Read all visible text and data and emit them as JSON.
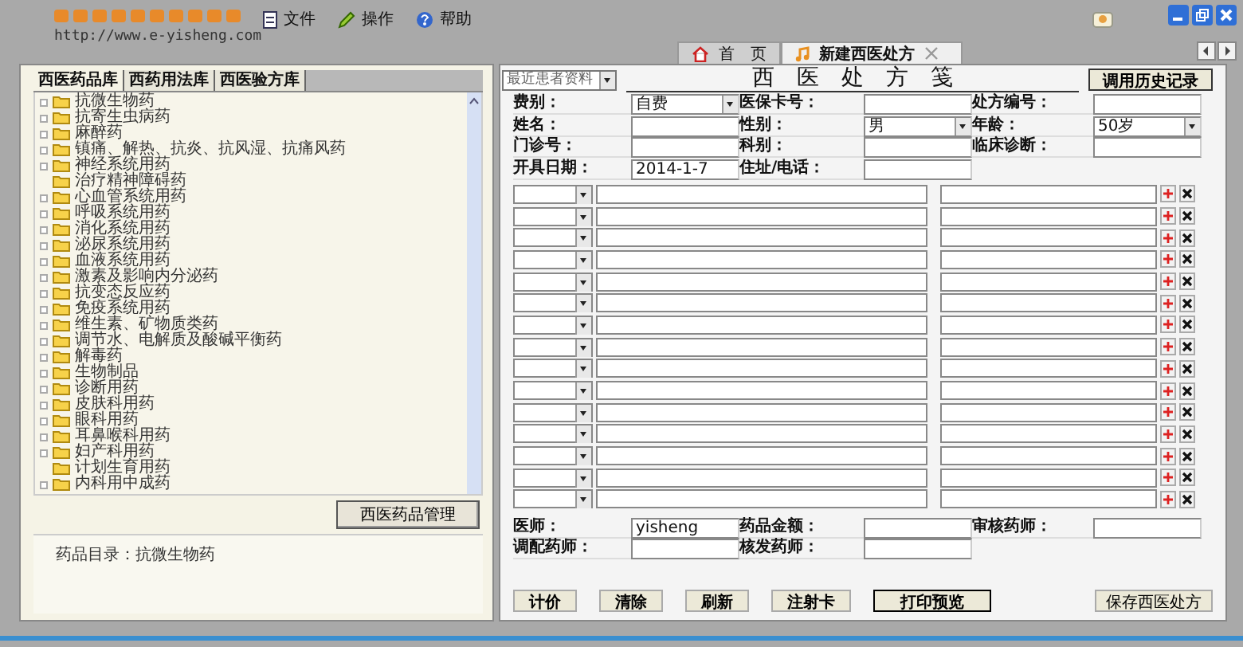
{
  "app": {
    "url": "http://www.e-yisheng.com"
  },
  "menu": [
    {
      "label": "文件"
    },
    {
      "label": "操作"
    },
    {
      "label": "帮助"
    }
  ],
  "tabs": [
    {
      "label": "首　页",
      "selected": false,
      "closable": false
    },
    {
      "label": "新建西医处方",
      "selected": true,
      "closable": true
    }
  ],
  "library_tabs": [
    {
      "label": "西医药品库",
      "selected": true
    },
    {
      "label": "西药用法库",
      "selected": false
    },
    {
      "label": "西医验方库",
      "selected": false
    }
  ],
  "tree": [
    {
      "label": "抗微生物药",
      "expandable": true
    },
    {
      "label": "抗寄生虫病药",
      "expandable": true
    },
    {
      "label": "麻醉药",
      "expandable": true
    },
    {
      "label": "镇痛、解热、抗炎、抗风湿、抗痛风药",
      "expandable": true
    },
    {
      "label": "神经系统用药",
      "expandable": true
    },
    {
      "label": "治疗精神障碍药",
      "expandable": false
    },
    {
      "label": "心血管系统用药",
      "expandable": true
    },
    {
      "label": "呼吸系统用药",
      "expandable": true
    },
    {
      "label": "消化系统用药",
      "expandable": true
    },
    {
      "label": "泌尿系统用药",
      "expandable": true
    },
    {
      "label": "血液系统用药",
      "expandable": true
    },
    {
      "label": "激素及影响内分泌药",
      "expandable": true
    },
    {
      "label": "抗变态反应药",
      "expandable": true
    },
    {
      "label": "免疫系统用药",
      "expandable": true
    },
    {
      "label": "维生素、矿物质类药",
      "expandable": true
    },
    {
      "label": "调节水、电解质及酸碱平衡药",
      "expandable": true
    },
    {
      "label": "解毒药",
      "expandable": true
    },
    {
      "label": "生物制品",
      "expandable": true
    },
    {
      "label": "诊断用药",
      "expandable": true
    },
    {
      "label": "皮肤科用药",
      "expandable": true
    },
    {
      "label": "眼科用药",
      "expandable": true
    },
    {
      "label": "耳鼻喉科用药",
      "expandable": true
    },
    {
      "label": "妇产科用药",
      "expandable": true
    },
    {
      "label": "计划生育用药",
      "expandable": false
    },
    {
      "label": "内科用中成药",
      "expandable": true
    }
  ],
  "manage_button": "西医药品管理",
  "catalog_note": "药品目录：抗微生物药",
  "patient_select": {
    "value": "最近患者资料"
  },
  "title": "西　医　处　方　笺",
  "history_button": "调用历史记录",
  "patient_rows": [
    [
      {
        "label": "费别：",
        "kind": "select",
        "value": "自费"
      },
      {
        "label": "医保卡号：",
        "kind": "text"
      },
      {
        "label": "处方编号：",
        "kind": "text"
      }
    ],
    [
      {
        "label": "姓名：",
        "kind": "text"
      },
      {
        "label": "性别：",
        "kind": "select",
        "value": "男"
      },
      {
        "label": "年龄：",
        "kind": "select",
        "value": "50岁"
      }
    ],
    [
      {
        "label": "门诊号：",
        "kind": "text"
      },
      {
        "label": "科别：",
        "kind": "text"
      },
      {
        "label": "临床诊断：",
        "kind": "text"
      }
    ],
    [
      {
        "label": "开具日期：",
        "kind": "text",
        "value": "2014-1-7"
      },
      {
        "label": "住址/电话：",
        "kind": "text"
      }
    ]
  ],
  "drug_lines": [
    {
      "kind": "drug-line"
    },
    {
      "kind": "drug-line"
    },
    {
      "kind": "drug-line"
    },
    {
      "kind": "drug-line"
    },
    {
      "kind": "drug-line"
    },
    {
      "kind": "drug-line"
    },
    {
      "kind": "drug-line"
    },
    {
      "kind": "drug-line"
    },
    {
      "kind": "drug-line"
    },
    {
      "kind": "drug-line"
    },
    {
      "kind": "drug-line"
    },
    {
      "kind": "drug-line"
    },
    {
      "kind": "drug-line"
    },
    {
      "kind": "drug-line"
    },
    {
      "kind": "drug-line"
    }
  ],
  "signature_rows": [
    [
      {
        "label": "医师：",
        "value": "yisheng"
      },
      {
        "label": "药品金额："
      },
      {
        "label": "审核药师："
      }
    ],
    [
      {
        "label": "调配药师："
      },
      {
        "label": "核发药师："
      }
    ]
  ],
  "actions": [
    {
      "label": "计价",
      "default": false
    },
    {
      "label": "清除",
      "default": false
    },
    {
      "label": "刷新",
      "default": false
    },
    {
      "label": "注射卡",
      "default": false
    },
    {
      "label": "打印预览",
      "default": true
    }
  ],
  "save_button": "保存西医处方"
}
